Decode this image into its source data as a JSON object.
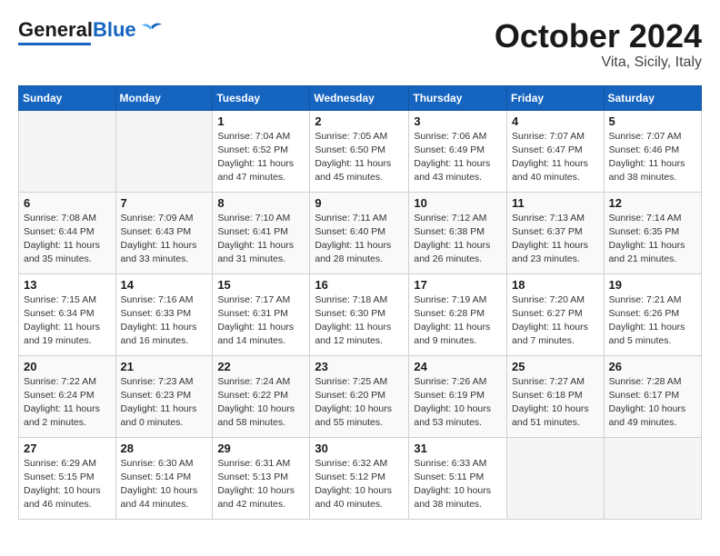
{
  "header": {
    "logo_general": "General",
    "logo_blue": "Blue",
    "month_title": "October 2024",
    "location": "Vita, Sicily, Italy"
  },
  "weekdays": [
    "Sunday",
    "Monday",
    "Tuesday",
    "Wednesday",
    "Thursday",
    "Friday",
    "Saturday"
  ],
  "weeks": [
    [
      {
        "day": "",
        "info": ""
      },
      {
        "day": "",
        "info": ""
      },
      {
        "day": "1",
        "info": "Sunrise: 7:04 AM\nSunset: 6:52 PM\nDaylight: 11 hours and 47 minutes."
      },
      {
        "day": "2",
        "info": "Sunrise: 7:05 AM\nSunset: 6:50 PM\nDaylight: 11 hours and 45 minutes."
      },
      {
        "day": "3",
        "info": "Sunrise: 7:06 AM\nSunset: 6:49 PM\nDaylight: 11 hours and 43 minutes."
      },
      {
        "day": "4",
        "info": "Sunrise: 7:07 AM\nSunset: 6:47 PM\nDaylight: 11 hours and 40 minutes."
      },
      {
        "day": "5",
        "info": "Sunrise: 7:07 AM\nSunset: 6:46 PM\nDaylight: 11 hours and 38 minutes."
      }
    ],
    [
      {
        "day": "6",
        "info": "Sunrise: 7:08 AM\nSunset: 6:44 PM\nDaylight: 11 hours and 35 minutes."
      },
      {
        "day": "7",
        "info": "Sunrise: 7:09 AM\nSunset: 6:43 PM\nDaylight: 11 hours and 33 minutes."
      },
      {
        "day": "8",
        "info": "Sunrise: 7:10 AM\nSunset: 6:41 PM\nDaylight: 11 hours and 31 minutes."
      },
      {
        "day": "9",
        "info": "Sunrise: 7:11 AM\nSunset: 6:40 PM\nDaylight: 11 hours and 28 minutes."
      },
      {
        "day": "10",
        "info": "Sunrise: 7:12 AM\nSunset: 6:38 PM\nDaylight: 11 hours and 26 minutes."
      },
      {
        "day": "11",
        "info": "Sunrise: 7:13 AM\nSunset: 6:37 PM\nDaylight: 11 hours and 23 minutes."
      },
      {
        "day": "12",
        "info": "Sunrise: 7:14 AM\nSunset: 6:35 PM\nDaylight: 11 hours and 21 minutes."
      }
    ],
    [
      {
        "day": "13",
        "info": "Sunrise: 7:15 AM\nSunset: 6:34 PM\nDaylight: 11 hours and 19 minutes."
      },
      {
        "day": "14",
        "info": "Sunrise: 7:16 AM\nSunset: 6:33 PM\nDaylight: 11 hours and 16 minutes."
      },
      {
        "day": "15",
        "info": "Sunrise: 7:17 AM\nSunset: 6:31 PM\nDaylight: 11 hours and 14 minutes."
      },
      {
        "day": "16",
        "info": "Sunrise: 7:18 AM\nSunset: 6:30 PM\nDaylight: 11 hours and 12 minutes."
      },
      {
        "day": "17",
        "info": "Sunrise: 7:19 AM\nSunset: 6:28 PM\nDaylight: 11 hours and 9 minutes."
      },
      {
        "day": "18",
        "info": "Sunrise: 7:20 AM\nSunset: 6:27 PM\nDaylight: 11 hours and 7 minutes."
      },
      {
        "day": "19",
        "info": "Sunrise: 7:21 AM\nSunset: 6:26 PM\nDaylight: 11 hours and 5 minutes."
      }
    ],
    [
      {
        "day": "20",
        "info": "Sunrise: 7:22 AM\nSunset: 6:24 PM\nDaylight: 11 hours and 2 minutes."
      },
      {
        "day": "21",
        "info": "Sunrise: 7:23 AM\nSunset: 6:23 PM\nDaylight: 11 hours and 0 minutes."
      },
      {
        "day": "22",
        "info": "Sunrise: 7:24 AM\nSunset: 6:22 PM\nDaylight: 10 hours and 58 minutes."
      },
      {
        "day": "23",
        "info": "Sunrise: 7:25 AM\nSunset: 6:20 PM\nDaylight: 10 hours and 55 minutes."
      },
      {
        "day": "24",
        "info": "Sunrise: 7:26 AM\nSunset: 6:19 PM\nDaylight: 10 hours and 53 minutes."
      },
      {
        "day": "25",
        "info": "Sunrise: 7:27 AM\nSunset: 6:18 PM\nDaylight: 10 hours and 51 minutes."
      },
      {
        "day": "26",
        "info": "Sunrise: 7:28 AM\nSunset: 6:17 PM\nDaylight: 10 hours and 49 minutes."
      }
    ],
    [
      {
        "day": "27",
        "info": "Sunrise: 6:29 AM\nSunset: 5:15 PM\nDaylight: 10 hours and 46 minutes."
      },
      {
        "day": "28",
        "info": "Sunrise: 6:30 AM\nSunset: 5:14 PM\nDaylight: 10 hours and 44 minutes."
      },
      {
        "day": "29",
        "info": "Sunrise: 6:31 AM\nSunset: 5:13 PM\nDaylight: 10 hours and 42 minutes."
      },
      {
        "day": "30",
        "info": "Sunrise: 6:32 AM\nSunset: 5:12 PM\nDaylight: 10 hours and 40 minutes."
      },
      {
        "day": "31",
        "info": "Sunrise: 6:33 AM\nSunset: 5:11 PM\nDaylight: 10 hours and 38 minutes."
      },
      {
        "day": "",
        "info": ""
      },
      {
        "day": "",
        "info": ""
      }
    ]
  ]
}
